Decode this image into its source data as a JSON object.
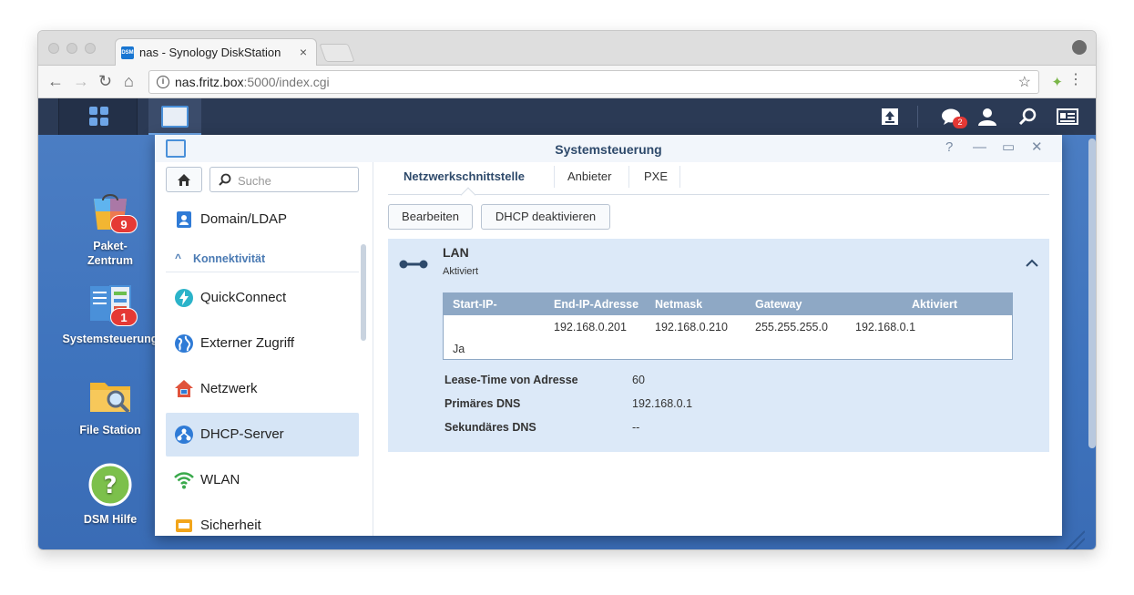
{
  "browser": {
    "tab_title": "nas - Synology DiskStation",
    "tab_favicon_text": "DSM",
    "url_host": "nas.fritz.box",
    "url_rest": ":5000/index.cgi"
  },
  "taskbar": {
    "notification_count": "2"
  },
  "desktop": {
    "icons": [
      {
        "label": "Paket-\nZentrum",
        "badge": "9",
        "icon": "package-center-icon"
      },
      {
        "label": "Systemsteuerung",
        "badge": "1",
        "icon": "control-panel-icon"
      },
      {
        "label": "File Station",
        "badge": "",
        "icon": "folder-search-icon"
      },
      {
        "label": "DSM Hilfe",
        "badge": "",
        "icon": "help-icon"
      }
    ]
  },
  "window": {
    "title": "Systemsteuerung"
  },
  "sidebar": {
    "search_placeholder": "Suche",
    "section": "Konnektivität",
    "items": [
      {
        "label": "Domain/LDAP",
        "icon": "domain-ldap-icon",
        "color": "#2f7bd6"
      },
      {
        "label": "QuickConnect",
        "icon": "quickconnect-icon",
        "color": "#2bb3c9"
      },
      {
        "label": "Externer Zugriff",
        "icon": "globe-icon",
        "color": "#2f7bd6"
      },
      {
        "label": "Netzwerk",
        "icon": "house-network-icon",
        "color": "#e0533c"
      },
      {
        "label": "DHCP-Server",
        "icon": "dhcp-icon",
        "color": "#2f7bd6"
      },
      {
        "label": "WLAN",
        "icon": "wifi-icon",
        "color": "#39a94b"
      },
      {
        "label": "Sicherheit",
        "icon": "security-icon",
        "color": "#f2a51a"
      }
    ]
  },
  "content": {
    "tabs": [
      "Netzwerkschnittstelle",
      "Anbieter",
      "PXE"
    ],
    "buttons": {
      "edit": "Bearbeiten",
      "disable_dhcp": "DHCP deaktivieren"
    },
    "lan": {
      "name": "LAN",
      "status": "Aktiviert",
      "table": {
        "headers": [
          "Start-IP-",
          "End-IP-Adresse",
          "Netmask",
          "Gateway",
          "Aktiviert"
        ],
        "row": [
          "192.168.0.201",
          "192.168.0.210",
          "255.255.255.0",
          "192.168.0.1",
          "Ja"
        ]
      },
      "details": [
        {
          "label": "Lease-Time von Adresse",
          "value": "60"
        },
        {
          "label": "Primäres DNS",
          "value": "192.168.0.1"
        },
        {
          "label": "Sekundäres DNS",
          "value": "--"
        }
      ]
    }
  }
}
